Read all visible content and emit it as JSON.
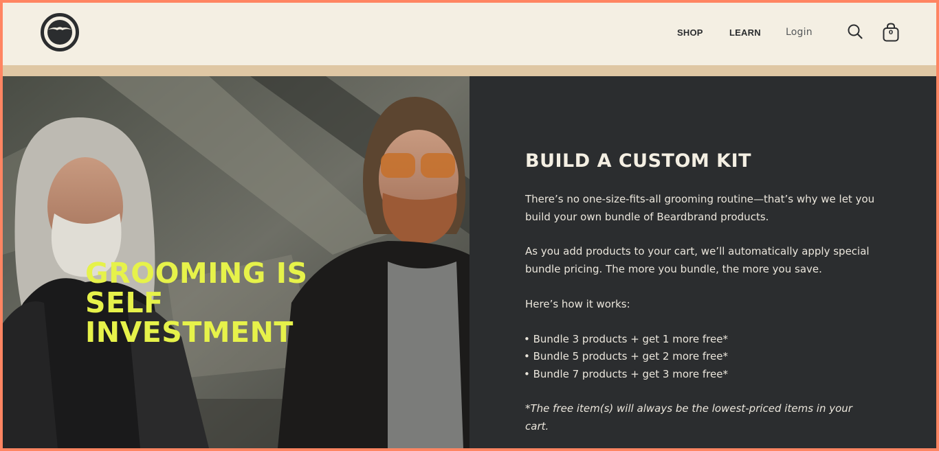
{
  "brand": {
    "logo_icon": "beard-mustache-logo-icon",
    "accent_color": "#e6f24a",
    "frame_color": "#ff8562"
  },
  "nav": {
    "shop": "SHOP",
    "learn": "LEARN",
    "login": "Login",
    "search_icon": "search-icon",
    "cart_icon": "shopping-bag-icon",
    "cart_count": "0"
  },
  "hero": {
    "title_lines": [
      "GROOMING IS",
      "SELF",
      "INVESTMENT"
    ]
  },
  "panel": {
    "title": "BUILD A CUSTOM KIT",
    "paragraph1": "There’s no one-size-fits-all grooming routine—that’s why we let you build your own bundle of Beardbrand products.",
    "paragraph2": "As you add products to your cart, we’ll automatically apply special bundle pricing. The more you bundle, the more you save.",
    "how_it_works": "Here’s how it works:",
    "bullets": [
      "• Bundle 3 products + get 1 more free*",
      "• Bundle 5 products + get 2 more free*",
      "• Bundle 7 products + get 3 more free*"
    ],
    "footnote": "*The free item(s) will always be the lowest-priced items in your cart."
  }
}
